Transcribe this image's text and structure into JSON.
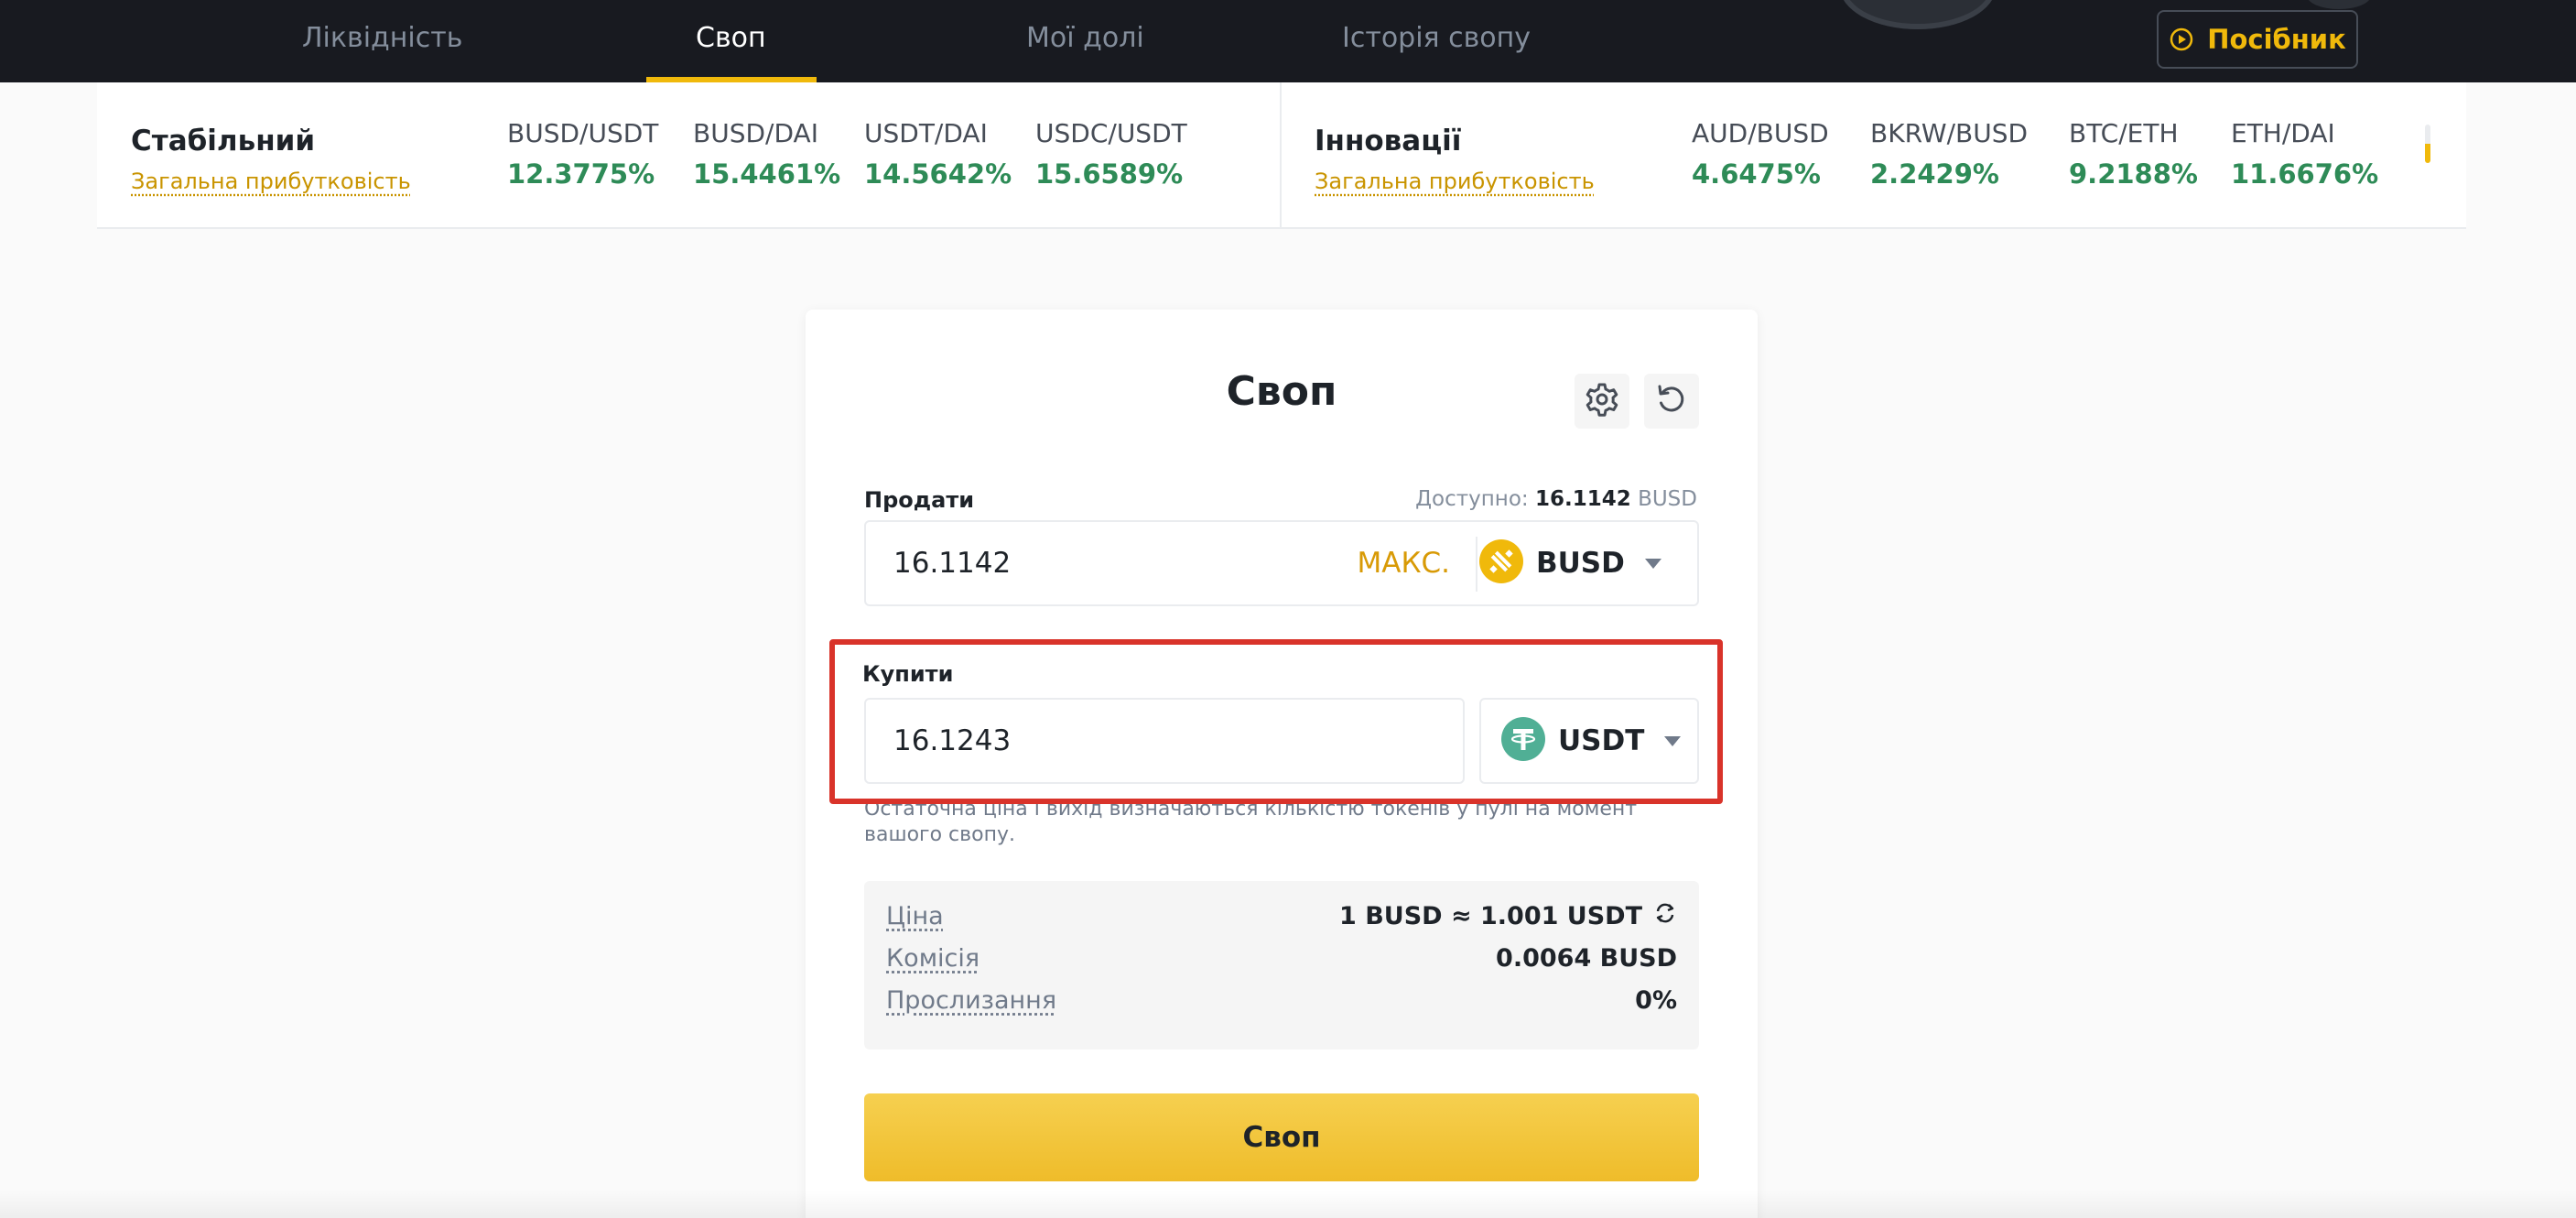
{
  "nav": {
    "tabs": [
      {
        "label": "Ліквідність"
      },
      {
        "label": "Своп"
      },
      {
        "label": "Мої долі"
      },
      {
        "label": "Історія свопу"
      }
    ],
    "guide_label": "Посібник"
  },
  "yields": {
    "stable": {
      "title": "Стабільний",
      "link": "Загальна прибутковість",
      "pairs": [
        {
          "name": "BUSD/USDT",
          "value": "12.3775%"
        },
        {
          "name": "BUSD/DAI",
          "value": "15.4461%"
        },
        {
          "name": "USDT/DAI",
          "value": "14.5642%"
        },
        {
          "name": "USDC/USDT",
          "value": "15.6589%"
        }
      ]
    },
    "innovation": {
      "title": "Інновації",
      "link": "Загальна прибутковість",
      "pairs": [
        {
          "name": "AUD/BUSD",
          "value": "4.6475%"
        },
        {
          "name": "BKRW/BUSD",
          "value": "2.2429%"
        },
        {
          "name": "BTC/ETH",
          "value": "9.2188%"
        },
        {
          "name": "ETH/DAI",
          "value": "11.6676%"
        }
      ]
    }
  },
  "swap": {
    "title": "Своп",
    "sell": {
      "label": "Продати",
      "available_label": "Доступно:",
      "available_amount": "16.1142",
      "available_unit": "BUSD",
      "amount": "16.1142",
      "max_label": "МАКС.",
      "token": "BUSD"
    },
    "buy": {
      "label": "Купити",
      "amount": "16.1243",
      "token": "USDT"
    },
    "note": "Остаточна ціна і вихід визначаються кількістю токенів у пулі на момент вашого свопу.",
    "info": {
      "price_label": "Ціна",
      "price_value": "1 BUSD ≈ 1.001 USDT",
      "fee_label": "Комісія",
      "fee_value": "0.0064 BUSD",
      "slippage_label": "Прослизання",
      "slippage_value": "0%"
    },
    "button_label": "Своп"
  },
  "colors": {
    "accent": "#f0b90b",
    "positive": "#2e8b57",
    "highlight": "#d9332a",
    "busd": "#f0b90b",
    "usdt": "#50af95"
  }
}
